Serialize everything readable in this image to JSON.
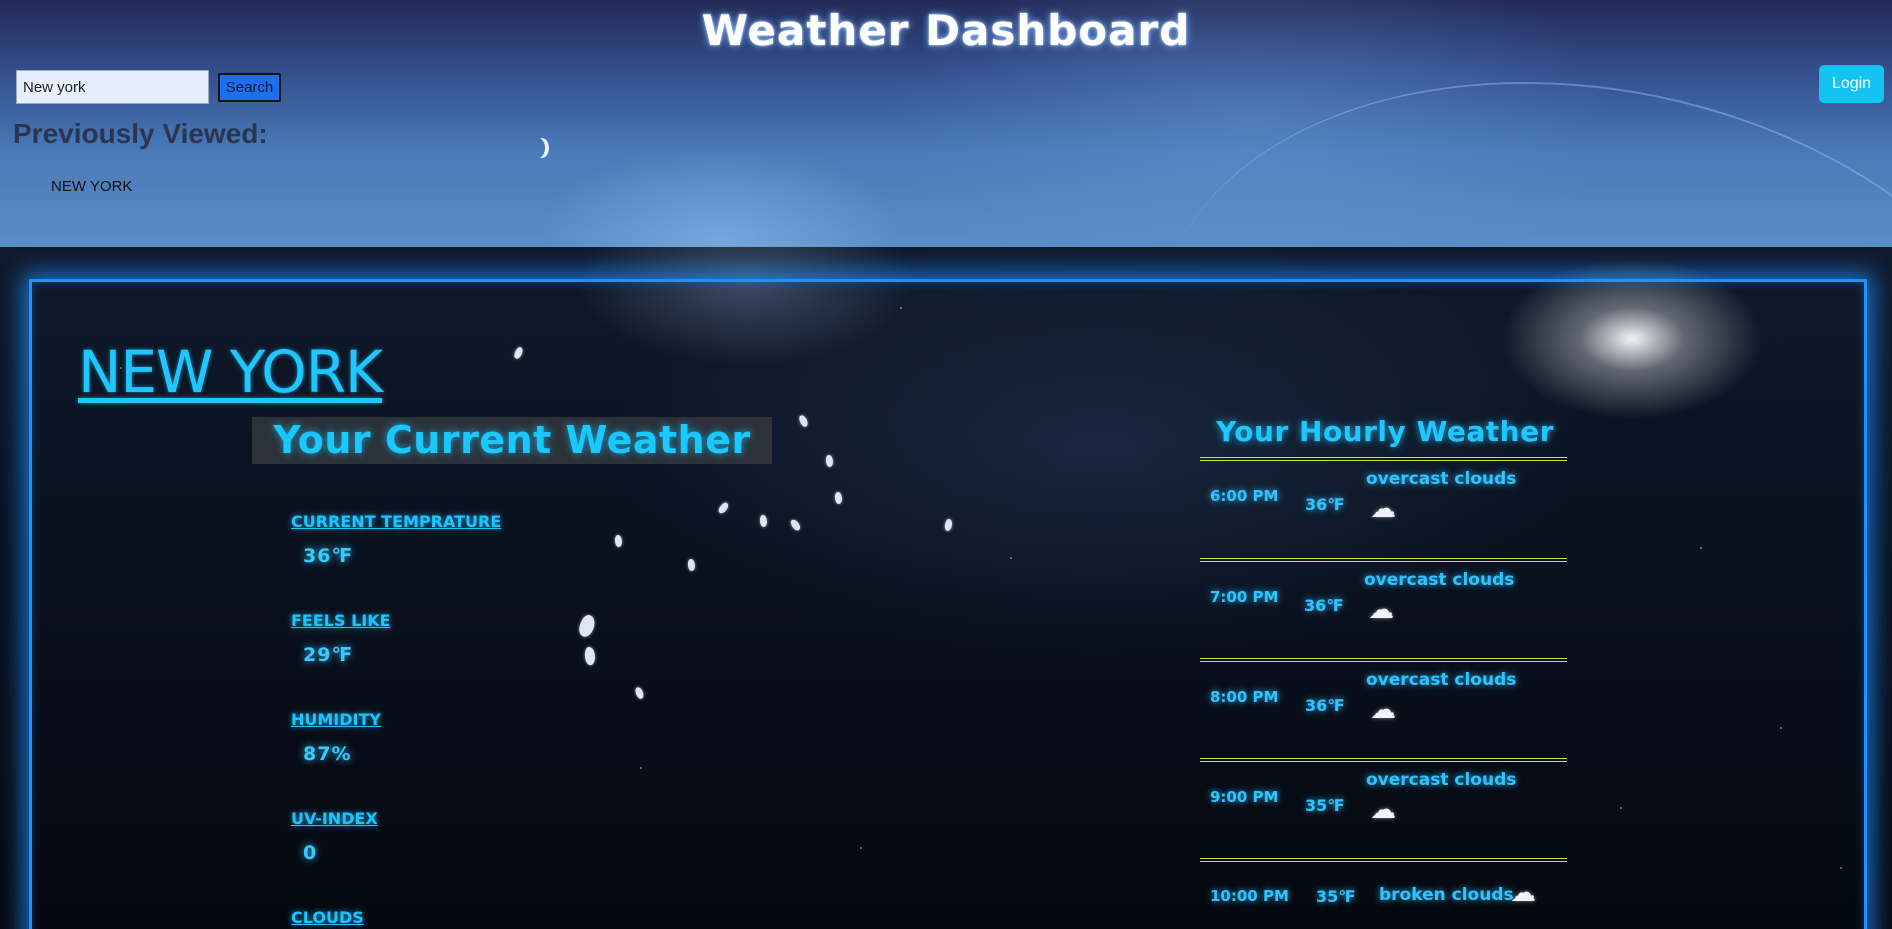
{
  "header": {
    "title": "Weather Dashboard",
    "search_value": "New york",
    "search_button": "Search",
    "login_button": "Login"
  },
  "history": {
    "heading": "Previously Viewed:",
    "items": [
      "NEW YORK"
    ]
  },
  "current": {
    "city": "NEW YORK",
    "heading": "Your Current Weather",
    "stats": [
      {
        "label": "CURRENT TEMPRATURE",
        "value": "36℉"
      },
      {
        "label": "FEELS LIKE",
        "value": "29℉"
      },
      {
        "label": "HUMIDITY",
        "value": "87%"
      },
      {
        "label": "UV-INDEX",
        "value": "0"
      },
      {
        "label": "CLOUDS",
        "value": ""
      }
    ]
  },
  "hourly": {
    "heading": "Your Hourly Weather",
    "items": [
      {
        "time": "6:00 PM",
        "temp": "36℉",
        "desc": "overcast clouds",
        "icon": "cloud-icon"
      },
      {
        "time": "7:00 PM",
        "temp": "36℉",
        "desc": "overcast clouds",
        "icon": "cloud-icon"
      },
      {
        "time": "8:00 PM",
        "temp": "36℉",
        "desc": "overcast clouds",
        "icon": "cloud-icon"
      },
      {
        "time": "9:00 PM",
        "temp": "35℉",
        "desc": "overcast clouds",
        "icon": "cloud-icon"
      },
      {
        "time": "10:00 PM",
        "temp": "35℉",
        "desc": "broken clouds",
        "icon": "cloud-icon"
      }
    ]
  },
  "icons": {
    "cloud": "☁"
  },
  "colors": {
    "accent": "#1ec8ff",
    "card_border": "#1e90ff",
    "rule": "#d7e03a",
    "login": "#12c4ef",
    "search": "#1d6ff2"
  }
}
